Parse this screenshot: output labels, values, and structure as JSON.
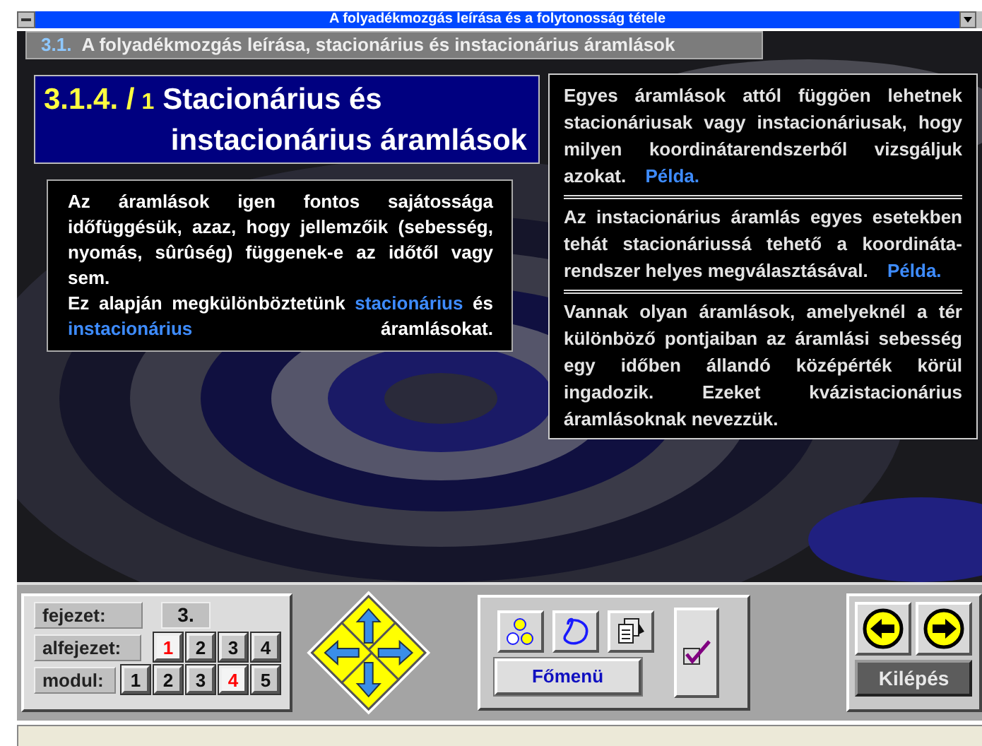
{
  "window": {
    "title": "A folyadékmozgás leírása és a folytonosság tétele"
  },
  "header": {
    "number": "3.1.",
    "title": "A folyadékmozgás leírása, stacionárius és instacionárius áramlások"
  },
  "section": {
    "number": "3.1.4. /",
    "page": "1",
    "title_lines": [
      "Stacionárius és",
      "instacionárius áramlások"
    ]
  },
  "intro": [
    {
      "parts": [
        {
          "kind": "plain",
          "text": "Az áramlások igen fontos sajátossága időfüggésük, azaz, hogy jellemzőik (sebesség, nyomás, sûrûség) függenek-e az időtől vagy sem."
        }
      ]
    },
    {
      "parts": [
        {
          "kind": "plain",
          "text": "Ez alapján megkülönböztetünk "
        },
        {
          "kind": "term",
          "text": "stacionárius"
        },
        {
          "kind": "plain",
          "text": " és "
        },
        {
          "kind": "term",
          "text": "instacionárius"
        },
        {
          "kind": "plain",
          "text": " áramlásokat."
        }
      ]
    }
  ],
  "notes": [
    {
      "text": "Egyes áramlások attól függöen lehetnek stacionáriusak vagy instacionáriusak, hogy milyen koordinátarendszerből vizsgáljuk azokat.",
      "link": "Példa."
    },
    {
      "text": "Az instacionárius áramlás egyes esetekben tehát stacionáriussá tehető a koordináta-rendszer helyes megválasztásával.",
      "link": "Példa."
    },
    {
      "text": "Vannak olyan áramlások, amelyeknél a tér különböző pontjaiban az áramlási sebesség egy időben állandó középérték körül ingadozik. Ezeket kvázistacionárius áramlásoknak nevezzük."
    }
  ],
  "navigation": {
    "chapter": {
      "label": "fejezet:",
      "value": "3."
    },
    "subchapter": {
      "label": "alfejezet:",
      "items": [
        {
          "label": "1",
          "selected": true
        },
        {
          "label": "2",
          "selected": false
        },
        {
          "label": "3",
          "selected": false
        },
        {
          "label": "4",
          "selected": false
        }
      ]
    },
    "module": {
      "label": "modul:",
      "items": [
        {
          "label": "1",
          "selected": false
        },
        {
          "label": "2",
          "selected": false
        },
        {
          "label": "3",
          "selected": false
        },
        {
          "label": "4",
          "selected": true
        },
        {
          "label": "5",
          "selected": false
        }
      ]
    }
  },
  "tools": {
    "main_menu": "Főmenü"
  },
  "exit": {
    "label": "Kilépés"
  }
}
